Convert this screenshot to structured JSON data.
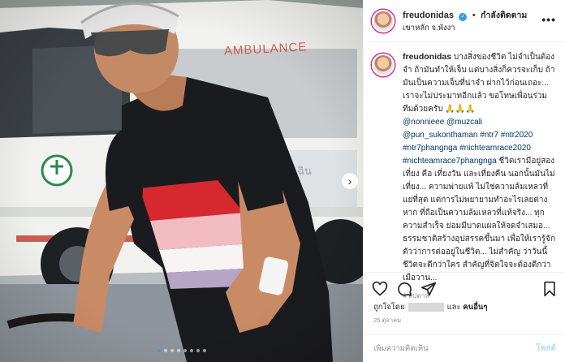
{
  "photo": {
    "van_text": "AMBULANCE",
    "dots_total": 8,
    "dot_active": 1,
    "colors": {
      "van": "#f1f2ef",
      "jersey": "#1a1b1f",
      "jersey_red": "#d7282f",
      "jersey_pink": "#f2bcc0",
      "road": "#8f959c"
    }
  },
  "header": {
    "username": "freudonidas",
    "verified_icon": "verified-badge-icon",
    "separator": "•",
    "follow_status": "กำลังติดตาม",
    "location": "เขาหลัก จ.พังงา",
    "more_icon": "•••"
  },
  "caption": {
    "username": "freudonidas",
    "text_lead": " บางสิ่งของชีวิต ไม่จำเป็นต้องจำ ถ้ามันทำให้เจ็บ แต่บางสิ่งก็ควรจะเก็บ ถ้ามันเป็นความเจ็บที่น่าจำ ฝากไว้ก่อนเถอะ... เราจะไม่ประมาทอีกแล้ว ขอโทษเพื่อนร่วมทีมด้วยครับ 🙏🙏🙏",
    "mentions": [
      "@nonnieee",
      "@muzcali",
      "@pun_sukonthaman"
    ],
    "hashtags": [
      "#ntr7",
      "#ntr2020",
      "#ntr7phangnga",
      "#nichteamrace2020",
      "#nichteamrace7phangnga"
    ],
    "text_tail": " ชีวิตเรามีอยู่สองเที่ยง คือ เที่ยงวัน และเที่ยงคืน นอกนั้นมันไม่เที่ยง... ความพ่ายแพ้ ไม่ใช่ความล้มเหลวที่แย่ที่สุด แต่การไม่พยายามทำอะไรเลยต่างหาก ที่ถือเป็นความล้มเหลวที่แท้จริง... ทุกความสำเร็จ ย่อมมีบาดแผลให้จดจำเสมอ... ธรรมชาติสร้างอุปสรรคขึ้นมา เพื่อให้เรารู้จักตัวว่าการต่ออยู่ในชีวิต... ไม่สำคัญ ว่าวันนี้ชีวิตจะดีกว่าใคร สำคัญที่จิตใจจะต้องดีกว่าเมื่อวาน...",
    "time_ago": "4 สัปดาห์"
  },
  "actions": {
    "like_icon": "heart-icon",
    "comment_icon": "comment-bubble-icon",
    "share_icon": "paper-plane-icon",
    "save_icon": "bookmark-icon"
  },
  "likes": {
    "prefix": "ถูกใจโดย",
    "joiner": "และ",
    "others": "คนอื่นๆ"
  },
  "date": "25 ตุลาคม",
  "comment": {
    "placeholder": "เพิ่มความคิดเห็น",
    "post_label": "โพสต์"
  }
}
